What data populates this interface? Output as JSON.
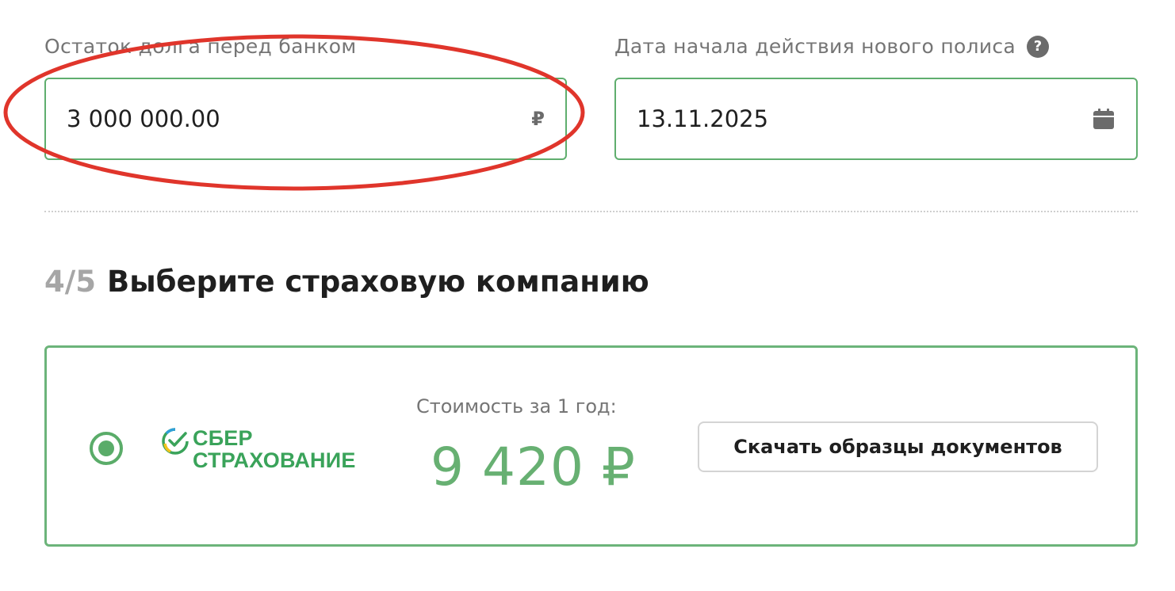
{
  "debt_field": {
    "label": "Остаток долга перед банком",
    "value": "3 000 000.00",
    "suffix": "₽"
  },
  "date_field": {
    "label": "Дата начала действия нового полиса",
    "help": "?",
    "value": "13.11.2025",
    "icon": "calendar-icon"
  },
  "annotation": {
    "shape": "ellipse",
    "color": "#e0352b"
  },
  "step": {
    "number": "4/5",
    "title": "Выберите страховую компанию"
  },
  "company": {
    "selected": true,
    "logo_line1": "СБЕР",
    "logo_line2": "СТРАХОВАНИЕ",
    "price_label": "Стоимость за 1 год:",
    "price": "9 420 ₽",
    "download_label": "Скачать образцы документов"
  },
  "colors": {
    "accent_green": "#5aac69",
    "price_green": "#67b072",
    "annotation_red": "#e0352b"
  }
}
